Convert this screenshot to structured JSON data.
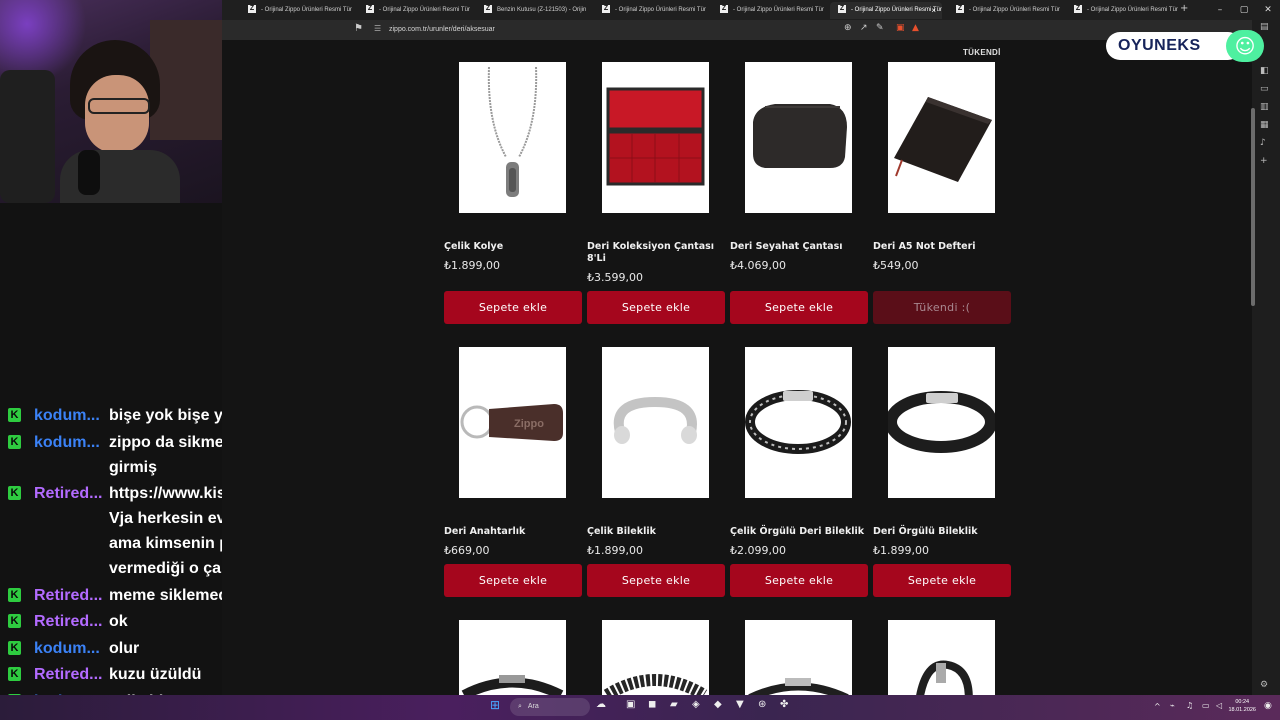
{
  "browser": {
    "tabs": [
      {
        "icon": "Z",
        "title": "- Orijinal Zippo Ürünleri Resmi Tür"
      },
      {
        "icon": "Z",
        "title": "- Orijinal Zippo Ürünleri Resmi Tür"
      },
      {
        "icon": "Z",
        "title": "Benzin Kutusu (Z-121503) - Orijin"
      },
      {
        "icon": "Z",
        "title": "- Orijinal Zippo Ürünleri Resmi Tür"
      },
      {
        "icon": "Z",
        "title": "- Orijinal Zippo Ürünleri Resmi Tür"
      },
      {
        "icon": "Z",
        "title": "- Orijinal Zippo Ürünleri Resmi Tür",
        "active": true
      },
      {
        "icon": "Z",
        "title": "- Orijinal Zippo Ürünleri Resmi Tür"
      },
      {
        "icon": "Z",
        "title": "- Orijinal Zippo Ürünleri Resmi Tür"
      }
    ],
    "new_tab": "+",
    "tab_close": "×",
    "window_controls": {
      "minimize": "–",
      "maximize": "▢",
      "close": "✕"
    },
    "url": "zippo.com.tr/urunler/deri/aksesuar"
  },
  "overlay": {
    "brand": "OYUNEKS"
  },
  "page": {
    "sold_out_label": "TÜKENDİ",
    "products": [
      {
        "name": "Çelik Kolye",
        "price": "₺1.899,00",
        "button": "Sepete ekle",
        "sold_out": false
      },
      {
        "name": "Deri Koleksiyon Çantası 8'Li",
        "price": "₺3.599,00",
        "button": "Sepete ekle",
        "sold_out": false
      },
      {
        "name": "Deri Seyahat Çantası",
        "price": "₺4.069,00",
        "button": "Sepete ekle",
        "sold_out": false
      },
      {
        "name": "Deri A5 Not Defteri",
        "price": "₺549,00",
        "button": "Tükendi :(",
        "sold_out": true
      },
      {
        "name": "Deri Anahtarlık",
        "price": "₺669,00",
        "button": "Sepete ekle",
        "sold_out": false
      },
      {
        "name": "Çelik Bileklik",
        "price": "₺1.899,00",
        "button": "Sepete ekle",
        "sold_out": false
      },
      {
        "name": "Çelik Örgülü Deri Bileklik",
        "price": "₺2.099,00",
        "button": "Sepete ekle",
        "sold_out": false
      },
      {
        "name": "Deri Örgülü Bileklik",
        "price": "₺1.899,00",
        "button": "Sepete ekle",
        "sold_out": false
      }
    ]
  },
  "chat": {
    "badge": "K",
    "messages": [
      {
        "user": "kodum...",
        "color": "blue",
        "text": "bişe yok bişe yok"
      },
      {
        "user": "kodum...",
        "color": "blue",
        "text": "zippo da sikme işine\ngirmiş"
      },
      {
        "user": "Retired...",
        "color": "purple",
        "text": "https://www.kisa.link/FF\nVja herkesin evinde olan\nama kimsenin para\nvermediği o çakmak"
      },
      {
        "user": "Retired...",
        "color": "purple",
        "text": "meme siklemedi"
      },
      {
        "user": "Retired...",
        "color": "purple",
        "text": "ok"
      },
      {
        "user": "kodum...",
        "color": "blue",
        "text": "olur"
      },
      {
        "user": "Retired...",
        "color": "purple",
        "text": "kuzu üzüldü"
      },
      {
        "user": "kodum...",
        "color": "blue",
        "text": "şalksjd"
      }
    ]
  },
  "taskbar": {
    "search_placeholder": "Ara",
    "time": "00:24",
    "date": "18.01.2026"
  }
}
